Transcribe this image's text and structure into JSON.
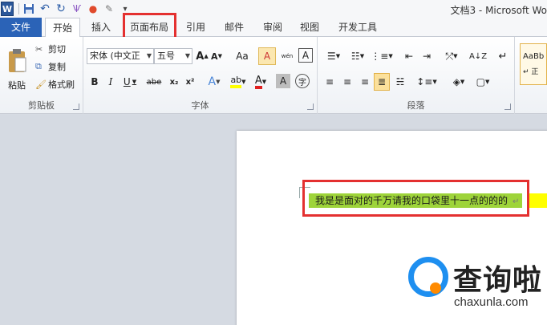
{
  "window": {
    "title": "文档3 - Microsoft Wo"
  },
  "quick_access": [
    {
      "name": "word-logo",
      "glyph": "W"
    },
    {
      "name": "save-icon",
      "glyph": "💾"
    },
    {
      "name": "undo-icon",
      "glyph": "↶"
    },
    {
      "name": "redo-icon",
      "glyph": "↻"
    },
    {
      "name": "format-painter-icon",
      "glyph": "Ѱ"
    },
    {
      "name": "color-icon",
      "glyph": "●"
    },
    {
      "name": "pen-icon",
      "glyph": "✎"
    },
    {
      "name": "customize-icon",
      "glyph": "▾"
    }
  ],
  "tabs": {
    "file": "文件",
    "home": "开始",
    "insert": "插入",
    "page_layout": "页面布局",
    "references": "引用",
    "mailings": "邮件",
    "review": "审阅",
    "view": "视图",
    "developer": "开发工具"
  },
  "clipboard": {
    "label": "剪贴板",
    "paste": "粘贴",
    "cut": "剪切",
    "copy": "复制",
    "format_painter": "格式刷"
  },
  "font": {
    "label": "字体",
    "name": "宋体 (中文正",
    "size": "五号",
    "bold": "B",
    "italic": "I",
    "underline": "U",
    "strike": "abe",
    "subscript": "x₂",
    "superscript": "x²",
    "grow": "A",
    "shrink": "A",
    "case": "Aa",
    "clear": "A",
    "phonetic": "wén",
    "char_border": "A",
    "char_shade": "A",
    "enclose": "字"
  },
  "paragraph": {
    "label": "段落"
  },
  "styles": {
    "sample": "AaBb",
    "sample2": "↵ 正"
  },
  "document": {
    "text": "我是是面对的千万请我的口袋里十一点的的的",
    "para_mark": "↵"
  },
  "watermark": {
    "text": "查询啦",
    "url": "chaxunla.com"
  },
  "colors": {
    "file_tab": "#2b63b7",
    "highlight_box": "#e43030",
    "text_highlight": "#9ed43a",
    "tail_highlight": "#ffff00"
  }
}
